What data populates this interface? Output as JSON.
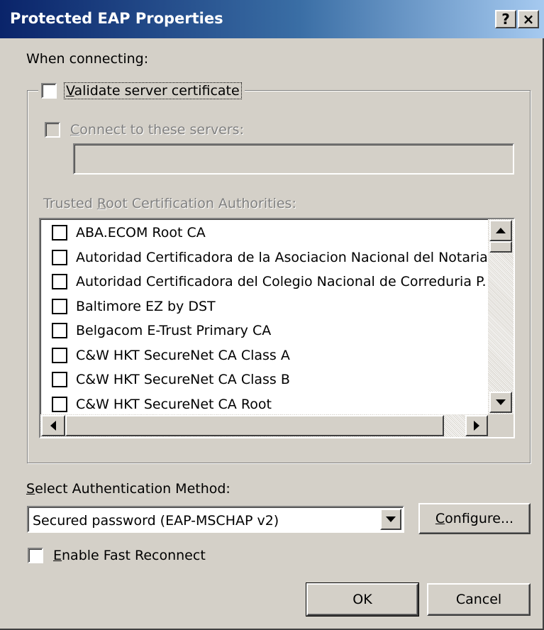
{
  "window": {
    "title": "Protected EAP Properties",
    "help_glyph": "?",
    "close_glyph": "×"
  },
  "when_connecting": {
    "label": "When connecting:"
  },
  "validate_cert": {
    "label_first": "V",
    "label_rest": "alidate server certificate",
    "checked": false
  },
  "connect_servers": {
    "label_first": "C",
    "label_rest": "onnect to these servers:",
    "checked": false,
    "enabled": false,
    "value": ""
  },
  "trusted_root": {
    "label_prefix": "Trusted ",
    "label_key": "R",
    "label_rest": "oot Certification Authorities:",
    "items": [
      {
        "label": "ABA.ECOM Root CA",
        "checked": false
      },
      {
        "label": "Autoridad Certificadora de la Asociacion Nacional del Notaria",
        "checked": false
      },
      {
        "label": "Autoridad Certificadora del Colegio Nacional de Correduria P.",
        "checked": false
      },
      {
        "label": "Baltimore EZ by DST",
        "checked": false
      },
      {
        "label": "Belgacom E-Trust Primary CA",
        "checked": false
      },
      {
        "label": "C&W HKT SecureNet CA Class A",
        "checked": false
      },
      {
        "label": "C&W HKT SecureNet CA Class B",
        "checked": false
      },
      {
        "label": "C&W HKT SecureNet CA Root",
        "checked": false
      }
    ]
  },
  "auth_method": {
    "label_first": "S",
    "label_rest": "elect Authentication Method:",
    "selected": "Secured password (EAP-MSCHAP v2)"
  },
  "configure_button": {
    "label_first": "C",
    "label_rest": "onfigure..."
  },
  "fast_reconnect": {
    "label_first": "E",
    "label_rest": "nable Fast Reconnect",
    "checked": false
  },
  "buttons": {
    "ok": "OK",
    "cancel": "Cancel"
  },
  "icons": {
    "scroll_up": "triangle-up-icon",
    "scroll_down": "triangle-down-icon",
    "scroll_left": "triangle-left-icon",
    "scroll_right": "triangle-right-icon",
    "dropdown": "triangle-down-icon"
  }
}
